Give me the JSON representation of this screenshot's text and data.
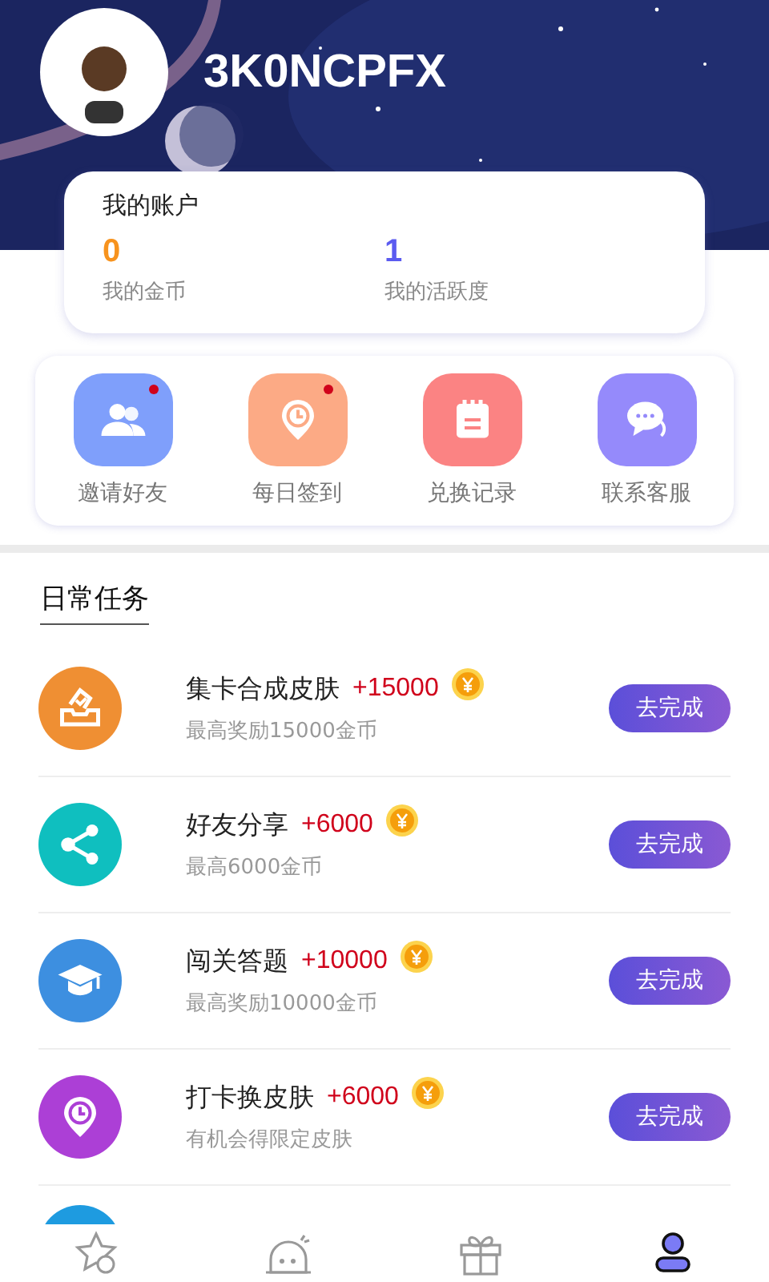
{
  "profile": {
    "username": "3K0NCPFX"
  },
  "account": {
    "title": "我的账户",
    "stats": [
      {
        "value": "0",
        "label": "我的金币",
        "color": "#f7931e"
      },
      {
        "value": "1",
        "label": "我的活跃度",
        "color": "#5b5bf0"
      }
    ]
  },
  "shortcuts": [
    {
      "label": "邀请好友",
      "kind": "friends",
      "color": "#7f9ffb",
      "badge": true
    },
    {
      "label": "每日签到",
      "kind": "checkin",
      "color": "#fcaa85",
      "badge": true
    },
    {
      "label": "兑换记录",
      "kind": "records",
      "color": "#fb8383",
      "badge": false
    },
    {
      "label": "联系客服",
      "kind": "support",
      "color": "#958afb",
      "badge": false
    }
  ],
  "section_title": "日常任务",
  "tasks": [
    {
      "title": "集卡合成皮肤",
      "reward": "+15000",
      "subtitle": "最高奖励15000金币",
      "kind": "cards",
      "color": "#ef8f33",
      "button": "去完成"
    },
    {
      "title": "好友分享",
      "reward": "+6000",
      "subtitle": "最高6000金币",
      "kind": "share",
      "color": "#0fbfbf",
      "button": "去完成"
    },
    {
      "title": "闯关答题",
      "reward": "+10000",
      "subtitle": "最高奖励10000金币",
      "kind": "quiz",
      "color": "#3d8fe0",
      "button": "去完成"
    },
    {
      "title": "打卡换皮肤",
      "reward": "+6000",
      "subtitle": "有机会得限定皮肤",
      "kind": "checkin",
      "color": "#ac3fd6",
      "button": "去完成"
    }
  ],
  "tabs": [
    {
      "kind": "help",
      "selected": false
    },
    {
      "kind": "bot",
      "selected": false
    },
    {
      "kind": "gifts",
      "selected": false
    },
    {
      "kind": "me",
      "selected": true
    }
  ]
}
